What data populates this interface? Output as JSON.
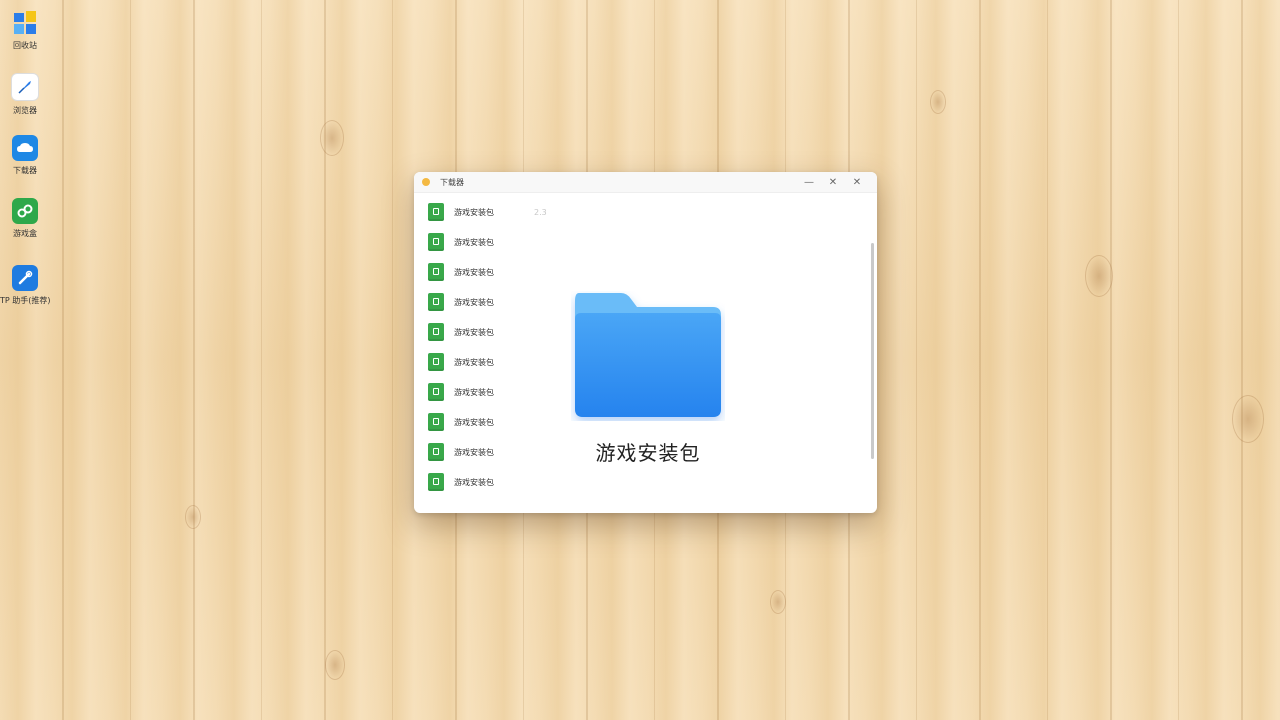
{
  "desktop": {
    "icons": [
      {
        "name": "windows-store",
        "label": "回收站",
        "color": "#2b7de9"
      },
      {
        "name": "feather-app",
        "label": "浏览器",
        "color": "#2b7de9"
      },
      {
        "name": "cloud-app",
        "label": "下载器",
        "color": "#1e88e5"
      },
      {
        "name": "game-app",
        "label": "游戏盒",
        "color": "#2ea84a"
      },
      {
        "name": "tool-app",
        "label": "TP 助手(推荐)",
        "color": "#1e7be0"
      }
    ]
  },
  "window": {
    "title": "下载器",
    "minimize_glyph": "—",
    "maximize_glyph": "✕",
    "close_glyph": "✕",
    "first_row_extra": "2.3",
    "files": [
      "游戏安装包",
      "游戏安装包",
      "游戏安装包",
      "游戏安装包",
      "游戏安装包",
      "游戏安装包",
      "游戏安装包",
      "游戏安装包",
      "游戏安装包",
      "游戏安装包"
    ],
    "preview": {
      "label": "游戏安装包",
      "folder_color_top": "#5ab0f7",
      "folder_color_body": "#2f8df0"
    }
  }
}
